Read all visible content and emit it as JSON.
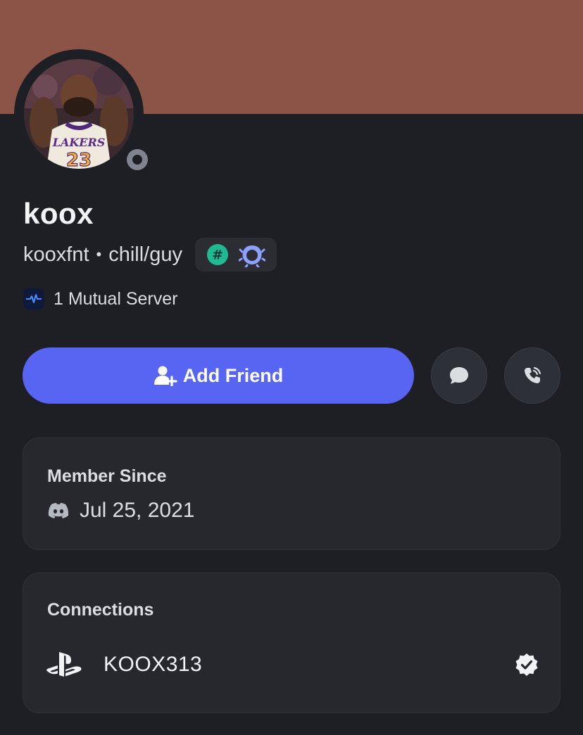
{
  "profile": {
    "display_name": "koox",
    "username": "kooxfnt",
    "separator": "•",
    "pronouns": "chill/guy",
    "status": "offline",
    "banner_color": "#8b5446",
    "avatar": {
      "icon": "user-avatar-photo",
      "jersey_text": "LAKERS",
      "jersey_number": "23"
    }
  },
  "badges": [
    {
      "name": "hashtag-badge",
      "color": "#1fb993",
      "glyph": "#"
    },
    {
      "name": "laurel-badge",
      "color": "#8ea0ff"
    }
  ],
  "mutual": {
    "icon": "server-pulse-icon",
    "label": "1 Mutual Server"
  },
  "actions": {
    "add_friend_label": "Add Friend",
    "add_friend_icon": "add-user-icon",
    "message_icon": "chat-bubble-icon",
    "call_icon": "phone-call-icon",
    "accent": "#5865f2"
  },
  "member_since": {
    "title": "Member Since",
    "icon": "discord-logo-icon",
    "date": "Jul 25, 2021"
  },
  "connections": {
    "title": "Connections",
    "items": [
      {
        "platform_icon": "playstation-icon",
        "name": "KOOX313",
        "verified_icon": "verified-check-icon"
      }
    ]
  }
}
